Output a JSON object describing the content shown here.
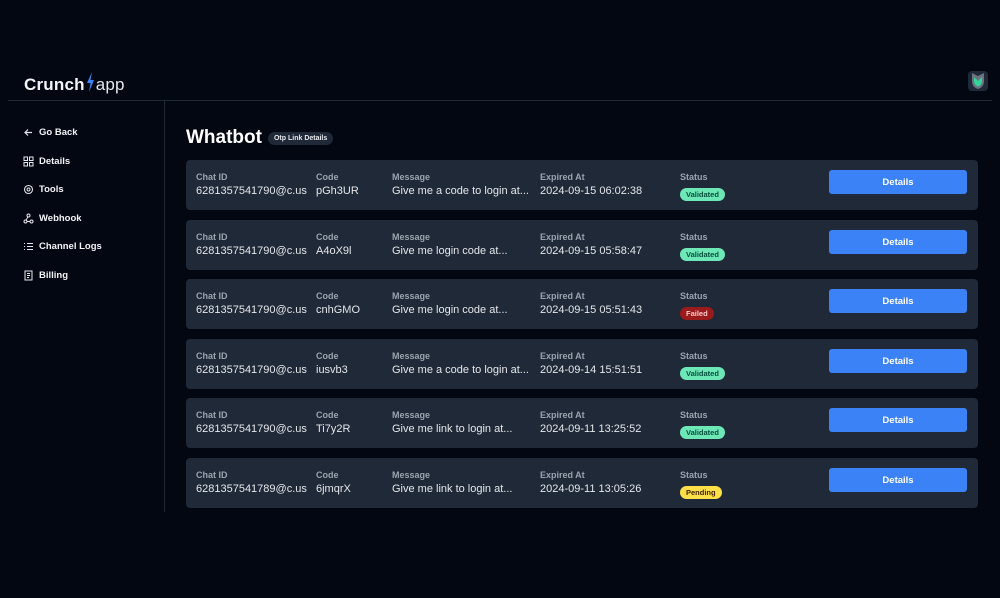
{
  "brand": {
    "left": "Crunch",
    "right": "app",
    "accent": "#3b82f6"
  },
  "sidebar": {
    "items": [
      {
        "label": "Go Back",
        "icon": "arrow-left-icon"
      },
      {
        "label": "Details",
        "icon": "grid-icon"
      },
      {
        "label": "Tools",
        "icon": "settings-icon"
      },
      {
        "label": "Webhook",
        "icon": "webhook-icon"
      },
      {
        "label": "Channel Logs",
        "icon": "list-icon"
      },
      {
        "label": "Billing",
        "icon": "receipt-icon"
      }
    ]
  },
  "main": {
    "title": "Whatbot",
    "pill": "Otp Link Details",
    "columns": {
      "chat_id": "Chat ID",
      "code": "Code",
      "message": "Message",
      "expired_at": "Expired At",
      "status": "Status"
    },
    "details_label": "Details",
    "rows": [
      {
        "chat_id": "6281357541790@c.us",
        "code": "pGh3UR",
        "message": "Give me a code to login at...",
        "expired_at": "2024-09-15 06:02:38",
        "status": "Validated"
      },
      {
        "chat_id": "6281357541790@c.us",
        "code": "A4oX9l",
        "message": "Give me login code at...",
        "expired_at": "2024-09-15 05:58:47",
        "status": "Validated"
      },
      {
        "chat_id": "6281357541790@c.us",
        "code": "cnhGMO",
        "message": "Give me login code at...",
        "expired_at": "2024-09-15 05:51:43",
        "status": "Failed"
      },
      {
        "chat_id": "6281357541790@c.us",
        "code": "iusvb3",
        "message": "Give me a code to login at...",
        "expired_at": "2024-09-14 15:51:51",
        "status": "Validated"
      },
      {
        "chat_id": "6281357541790@c.us",
        "code": "Ti7y2R",
        "message": "Give me link to login at...",
        "expired_at": "2024-09-11 13:25:52",
        "status": "Validated"
      },
      {
        "chat_id": "6281357541789@c.us",
        "code": "6jmqrX",
        "message": "Give me link to login at...",
        "expired_at": "2024-09-11 13:05:26",
        "status": "Pending"
      }
    ]
  },
  "colors": {
    "background": "#030712",
    "card": "#1f2937",
    "button": "#3b82f6",
    "validated": "#6ee7b7",
    "failed": "#991b1b",
    "pending": "#fde047"
  }
}
